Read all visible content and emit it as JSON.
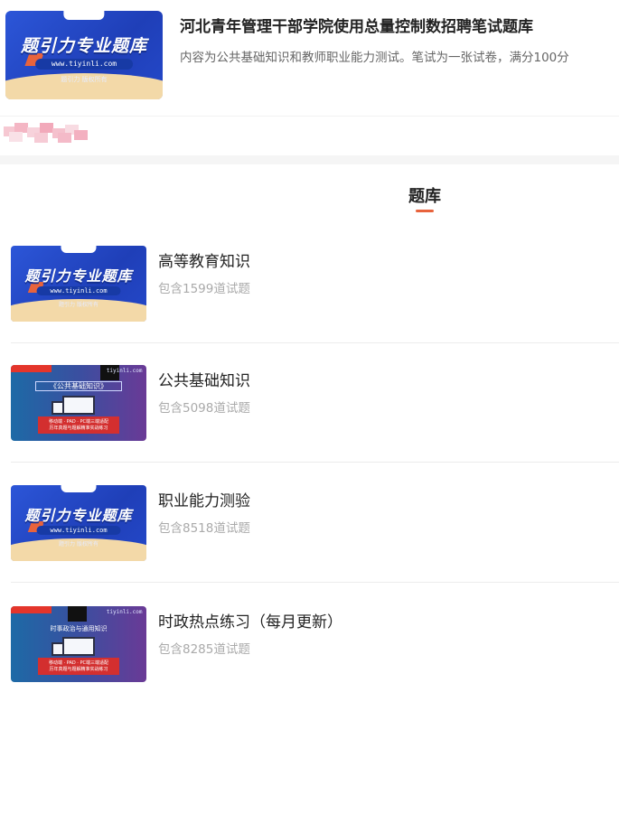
{
  "header": {
    "title": "河北青年管理干部学院使用总量控制数招聘笔试题库",
    "description": "内容为公共基础知识和教师职业能力测试。笔试为一张试卷，满分100分",
    "cover": {
      "brand_text": "题引力专业题库",
      "url_text": "www.tiyinli.com",
      "copyright_text": "题引力 版权所有"
    }
  },
  "section": {
    "title": "题库"
  },
  "items": [
    {
      "title": "高等教育知识",
      "count": "包含1599道试题",
      "cover": {
        "style": "blue",
        "brand_text": "题引力专业题库",
        "url_text": "www.tiyinli.com",
        "copyright_text": "题引力 版权所有"
      }
    },
    {
      "title": "公共基础知识",
      "count": "包含5098道试题",
      "cover": {
        "style": "gradient",
        "banner_text": "《公共基础知识》",
        "red_text_1": "移动端 · PAD · PC端三端适配",
        "red_text_2": "历年真题与题解精准实战练习",
        "site_text": "tiyinli.com"
      }
    },
    {
      "title": "职业能力测验",
      "count": "包含8518道试题",
      "cover": {
        "style": "blue",
        "brand_text": "题引力专业题库",
        "url_text": "www.tiyinli.com",
        "copyright_text": "题引力 版权所有"
      }
    },
    {
      "title": "时政热点练习（每月更新）",
      "count": "包含8285道试题",
      "cover": {
        "style": "gradient",
        "banner_text": "时事政治与通用知识",
        "red_text_1": "移动端 · PAD · PC端三端适配",
        "red_text_2": "历年真题与题解精准实战练习",
        "site_text": "tiyinli.com"
      }
    }
  ],
  "colors": {
    "accent": "#e8633c",
    "brand_blue": "#2c56d8"
  }
}
